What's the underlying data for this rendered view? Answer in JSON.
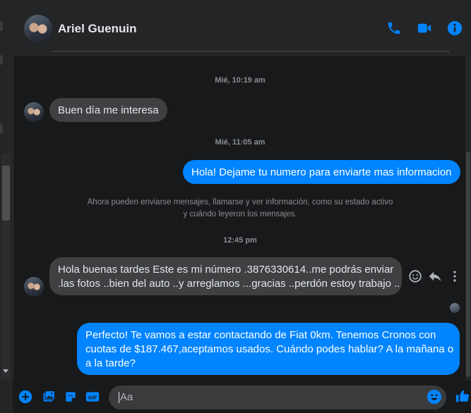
{
  "header": {
    "contact_name": "Ariel Guenuin"
  },
  "icons": {
    "accent": "#0084ff"
  },
  "messages": {
    "ts1": "Mié, 10:19 am",
    "m1": "Buen día me interesa",
    "ts2": "Mié, 11:05 am",
    "m2": "Hola! Dejame tu numero para enviarte mas informacion",
    "notice": "Ahora pueden enviarse mensajes, llamarse y ver información, como su estado activo y cuándo leyeron los mensajes.",
    "ts3": "12:45 pm",
    "m3_line1": "Hola  buenas tardes Este es mi número .3876330614..me podrás enviar",
    "m3_line2": ".las fotos ..bien del auto ..y arreglamos ...gracias ..perdón estoy trabajo ..",
    "m4_line1": "Perfecto! Te vamos a estar contactando de Fiat 0km. Tenemos Cronos con",
    "m4_line2": "cuotas de $187.467,aceptamos usados. Cuándo podes hablar? A la mañana o",
    "m4_line3": "a la tarde?"
  },
  "composer": {
    "placeholder": "Aa"
  }
}
